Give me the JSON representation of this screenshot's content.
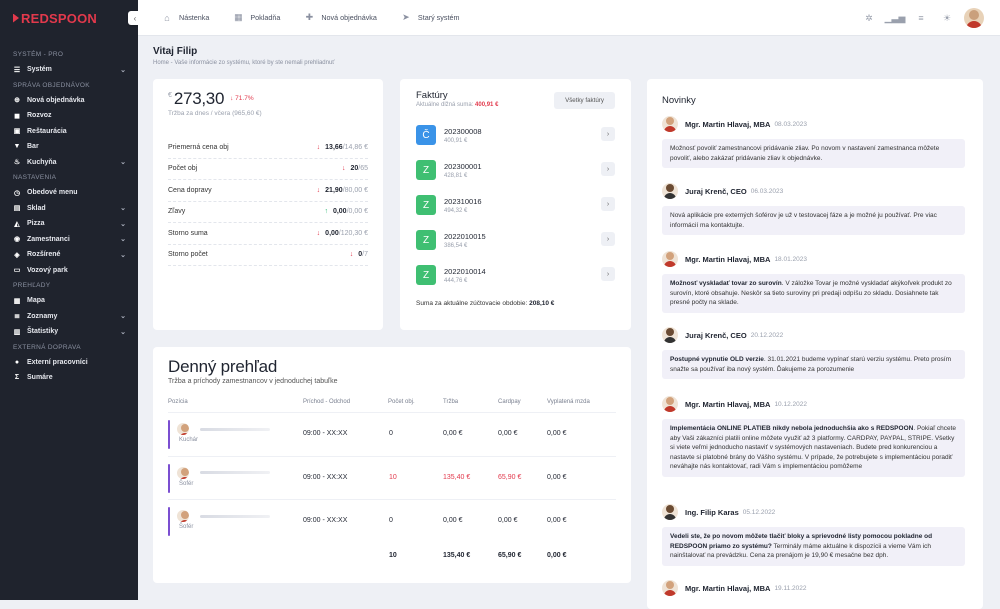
{
  "brand": {
    "prefix": "|",
    "name": "REDSPOON"
  },
  "sidebar": {
    "collapse_icon": "chevron-left",
    "sections": [
      {
        "title": "SYSTÉM - PRO",
        "items": [
          {
            "label": "Systém",
            "icon": "menu-icon",
            "chev": true
          }
        ]
      },
      {
        "title": "SPRÁVA OBJEDNÁVOK",
        "items": [
          {
            "label": "Nová objednávka",
            "icon": "plus-circle-icon"
          },
          {
            "label": "Rozvoz",
            "icon": "car-icon"
          },
          {
            "label": "Reštaurácia",
            "icon": "store-icon"
          },
          {
            "label": "Bar",
            "icon": "glass-icon"
          },
          {
            "label": "Kuchyňa",
            "icon": "chef-icon",
            "chev": true
          }
        ]
      },
      {
        "title": "NASTAVENIA",
        "items": [
          {
            "label": "Obedové menu",
            "icon": "clock-icon"
          },
          {
            "label": "Sklad",
            "icon": "box-icon",
            "chev": true
          },
          {
            "label": "Pizza",
            "icon": "pizza-icon",
            "chev": true
          },
          {
            "label": "Zamestnanci",
            "icon": "users-icon",
            "chev": true
          },
          {
            "label": "Rozšírené",
            "icon": "layers-icon",
            "chev": true
          },
          {
            "label": "Vozový park",
            "icon": "truck-icon"
          }
        ]
      },
      {
        "title": "PREHĽADY",
        "items": [
          {
            "label": "Mapa",
            "icon": "map-icon"
          },
          {
            "label": "Zoznamy",
            "icon": "list-icon",
            "chev": true
          },
          {
            "label": "Štatistiky",
            "icon": "bars-icon",
            "chev": true
          }
        ]
      },
      {
        "title": "EXTERNÁ DOPRAVA",
        "items": [
          {
            "label": "Externí pracovníci",
            "icon": "user-icon"
          },
          {
            "label": "Sumáre",
            "icon": "sum-icon"
          }
        ]
      }
    ]
  },
  "topbar": {
    "links": [
      {
        "label": "Nástenka",
        "icon": "home-icon"
      },
      {
        "label": "Pokladňa",
        "icon": "register-icon"
      },
      {
        "label": "Nová objednávka",
        "icon": "plus-icon"
      },
      {
        "label": "Starý systém",
        "icon": "cursor-icon"
      }
    ]
  },
  "page": {
    "title": "Vitaj Filip",
    "breadcrumb": "Home  -  Vaše informácie zo systému, ktoré by ste nemali prehliadnuť"
  },
  "stats": {
    "currency": "€",
    "amount": "273,30",
    "change": "↓ 71.7%",
    "sub": "Tržba za dnes / včera (965,60 €)",
    "rows": [
      {
        "label": "Priemerná cena obj",
        "arrow": "↓",
        "up": false,
        "value": "13,66",
        "prev": "/14,86 €"
      },
      {
        "label": "Počet obj",
        "arrow": "↓",
        "up": false,
        "value": "20",
        "prev": "/65"
      },
      {
        "label": "Cena dopravy",
        "arrow": "↓",
        "up": false,
        "value": "21,90",
        "prev": "/80,00 €"
      },
      {
        "label": "Zľavy",
        "arrow": "↑",
        "up": true,
        "value": "0,00",
        "prev": "/0,00 €"
      },
      {
        "label": "Storno suma",
        "arrow": "↓",
        "up": false,
        "value": "0,00",
        "prev": "/120,30 €"
      },
      {
        "label": "Storno počet",
        "arrow": "↓",
        "up": false,
        "value": "0",
        "prev": "/7"
      }
    ]
  },
  "invoices": {
    "title": "Faktúry",
    "sub_label": "Aktuálne dlžná suma: ",
    "sub_amount": "400,91 €",
    "button": "Všetky faktúry",
    "items": [
      {
        "letter": "Č",
        "kind": "c",
        "number": "202300008",
        "amount": "400,91 €"
      },
      {
        "letter": "Z",
        "kind": "z",
        "number": "202300001",
        "amount": "428,81 €"
      },
      {
        "letter": "Z",
        "kind": "z",
        "number": "202310016",
        "amount": "494,32 €"
      },
      {
        "letter": "Z",
        "kind": "z",
        "number": "2022010015",
        "amount": "386,54 €"
      },
      {
        "letter": "Z",
        "kind": "z",
        "number": "2022010014",
        "amount": "444,76 €"
      }
    ],
    "footer_label": "Suma za aktuálne zúčtovacie obdobie: ",
    "footer_amount": "208,10 €"
  },
  "news": {
    "title": "Novinky",
    "items": [
      {
        "author": "Mgr. Martin Hlavaj, MBA",
        "date": "08.03.2023",
        "dark": false,
        "bold": "",
        "text": "Možnosť povoliť zamestnancovi pridávanie zliav. Po novom v nastavení zamestnanca môžete povoliť, alebo zakázať pridávanie zliav k objednávke."
      },
      {
        "author": "Juraj Krenč, CEO",
        "date": "06.03.2023",
        "dark": true,
        "bold": "",
        "text": "Nová aplikácie pre externých šoférov je už v testovacej fáze a je možné ju používať. Pre viac informácií ma kontaktujte."
      },
      {
        "author": "Mgr. Martin Hlavaj, MBA",
        "date": "18.01.2023",
        "dark": false,
        "bold": "Možnosť vyskladať tovar zo surovín",
        "text": ". V záložke Tovar je možné vyskladať akýkoľvek produkt zo surovín, ktoré obsahuje. Neskôr sa tieto suroviny pri predaji odpíšu zo skladu. Dosiahnete tak presné počty na sklade."
      },
      {
        "author": "Juraj Krenč, CEO",
        "date": "20.12.2022",
        "dark": true,
        "bold": "Postupné vypnutie OLD verzie",
        "text": ". 31.01.2021 budeme vypínať starú verziu systému. Preto prosím snažte sa používať iba nový systém. Ďakujeme za porozumenie"
      },
      {
        "author": "Mgr. Martin Hlavaj, MBA",
        "date": "10.12.2022",
        "dark": false,
        "bold": "Implementácia ONLINE PLATIEB nikdy nebola jednoduchšia ako s REDSPOON",
        "text": ". Pokiaľ chcete aby Vaši zákazníci platili online môžete využiť až 3 platformy. CARDPAY, PAYPAL, STRIPE. Všetky si viete veľmi jednoducho nastaviť v systémových nastaveniach. Budete pred konkurenciou a nastavte si platobné brány do Vášho systému. V prípade, že potrebujete s implementáciou poradiť neváhajte nás kontaktovať, radi Vám s implementáciou pomôžeme"
      },
      {
        "author": "Ing. Filip Karas",
        "date": "05.12.2022",
        "dark": true,
        "bold": "Vedeli ste, že po novom môžete tlačiť bloky a sprievodné listy pomocou pokladne od REDSPOON priamo zo systému?",
        "text": " Terminály máme aktuálne k dispozícii a vieme Vám ich nainštalovať na prevádzku. Cena za prenájom je 19,90 € mesačne bez dph."
      },
      {
        "author": "Mgr. Martin Hlavaj, MBA",
        "date": "19.11.2022",
        "dark": false,
        "bold": "",
        "text": ""
      }
    ]
  },
  "daily": {
    "title": "Denný prehľad",
    "sub": "Tržba a príchody zamestnancov v jednoduchej tabuľke",
    "headers": [
      "Pozícia",
      "Príchod - Odchod",
      "Počet obj.",
      "Tržba",
      "Cardpay",
      "Vyplatená mzda"
    ],
    "rows": [
      {
        "role": "Kuchár",
        "time": "09:00 - XX:XX",
        "orders": "0",
        "revenue": "0,00 €",
        "cardpay": "0,00 €",
        "wage": "0,00 €",
        "hl": false
      },
      {
        "role": "Šofér",
        "time": "09:00 - XX:XX",
        "orders": "10",
        "revenue": "135,40 €",
        "cardpay": "65,90 €",
        "wage": "0,00 €",
        "hl": true
      },
      {
        "role": "Šofér",
        "time": "09:00 - XX:XX",
        "orders": "0",
        "revenue": "0,00 €",
        "cardpay": "0,00 €",
        "wage": "0,00 €",
        "hl": false
      }
    ],
    "totals": {
      "orders": "10",
      "revenue": "135,40 €",
      "cardpay": "65,90 €",
      "wage": "0,00 €"
    }
  }
}
